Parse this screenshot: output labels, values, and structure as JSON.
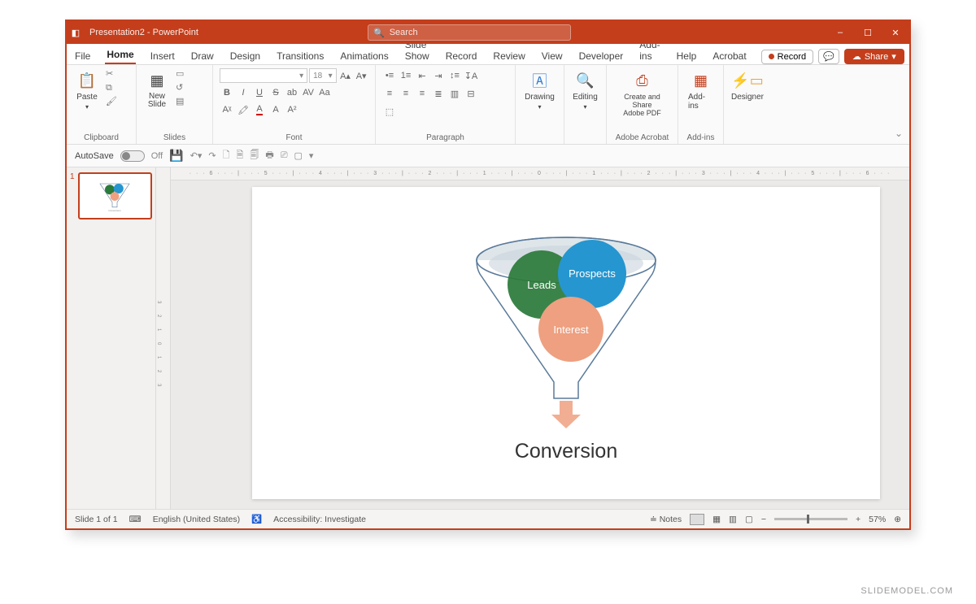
{
  "titlebar": {
    "title": "Presentation2 - PowerPoint",
    "search_placeholder": "Search"
  },
  "window": {
    "min": "–",
    "max": "☐",
    "close": "✕"
  },
  "menu": {
    "tabs": [
      "File",
      "Home",
      "Insert",
      "Draw",
      "Design",
      "Transitions",
      "Animations",
      "Slide Show",
      "Record",
      "Review",
      "View",
      "Developer",
      "Add-ins",
      "Help",
      "Acrobat"
    ],
    "active": "Home",
    "record_btn": "Record",
    "share_btn": "Share"
  },
  "ribbon": {
    "clipboard": {
      "paste": "Paste",
      "label": "Clipboard"
    },
    "slides": {
      "newslide": "New\nSlide",
      "label": "Slides"
    },
    "font": {
      "size": "18",
      "label": "Font",
      "bold": "B",
      "italic": "I",
      "underline": "U",
      "strike": "S",
      "av": "AV",
      "aa": "Aa"
    },
    "paragraph": {
      "label": "Paragraph"
    },
    "drawing": {
      "label": "Drawing"
    },
    "editing": {
      "label": "Editing"
    },
    "adobe": {
      "btn": "Create and Share\nAdobe PDF",
      "label": "Adobe Acrobat"
    },
    "addins": {
      "btn": "Add-ins",
      "label": "Add-ins"
    },
    "designer": {
      "btn": "Designer"
    }
  },
  "qat": {
    "autosave": "AutoSave",
    "off": "Off"
  },
  "thumb": {
    "num": "1"
  },
  "slide": {
    "circle1": "Leads",
    "circle2": "Prospects",
    "circle3": "Interest",
    "caption": "Conversion"
  },
  "status": {
    "slide": "Slide 1 of 1",
    "lang": "English (United States)",
    "access": "Accessibility: Investigate",
    "notes": "Notes",
    "zoom": "57%"
  },
  "hruler_text": "· · · 6 · · · | · · · 5 · · · | · · · 4 · · · | · · · 3 · · · | · · · 2 · · · | · · · 1 · · · | · · · 0 · · · | · · · 1 · · · | · · · 2 · · · | · · · 3 · · · | · · · 4 · · · | · · · 5 · · · | · · · 6 · · ·",
  "watermark": "SLIDEMODEL.COM"
}
